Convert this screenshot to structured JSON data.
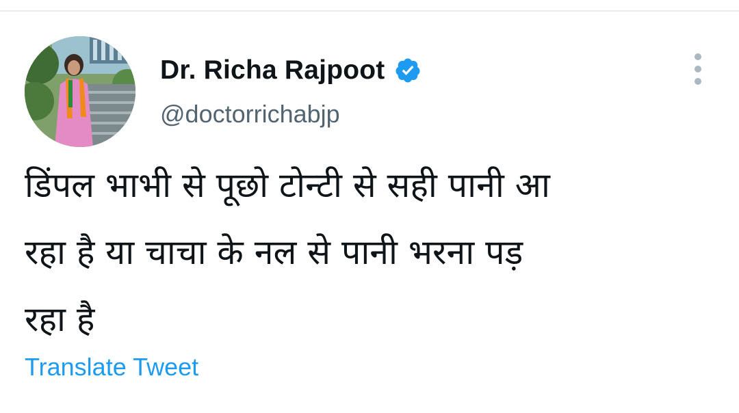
{
  "author": {
    "display_name": "Dr. Richa Rajpoot",
    "handle": "@doctorrichabjp",
    "verified": true
  },
  "tweet": {
    "text_lines": [
      "डिंपल भाभी से पूछो टोन्टी से सही पानी आ",
      "रहा है या चाचा के नल से पानी भरना पड़",
      "रहा है"
    ]
  },
  "actions": {
    "translate_label": "Translate Tweet",
    "more_icon": "more-vertical-icon"
  },
  "colors": {
    "verified_badge": "#1d9bf0",
    "link": "#1d9bf0",
    "handle": "#536471",
    "text": "#0f1419",
    "more_dots": "#aab8c2",
    "divider": "#e7e9ea"
  }
}
